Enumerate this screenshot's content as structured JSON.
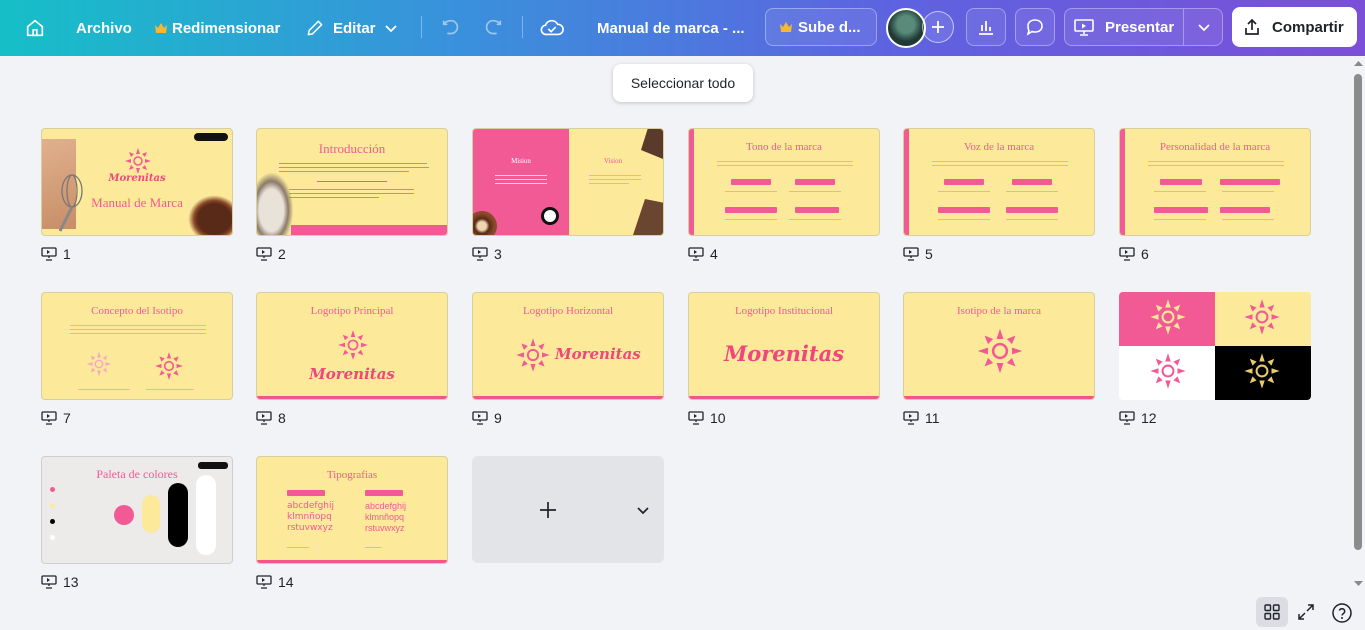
{
  "topbar": {
    "file_label": "Archivo",
    "resize_label": "Redimensionar",
    "edit_label": "Editar",
    "doc_title": "Manual de marca - ...",
    "upgrade_label": "Sube d...",
    "present_label": "Presentar",
    "share_label": "Compartir"
  },
  "tooltip": "Seleccionar todo",
  "slides": [
    {
      "num": "1",
      "title": "Manual de Marca",
      "brand": "Morenitas"
    },
    {
      "num": "2",
      "title": "Introducción"
    },
    {
      "num": "3",
      "left": "Mision",
      "right": "Vision"
    },
    {
      "num": "4",
      "title": "Tono de la marca"
    },
    {
      "num": "5",
      "title": "Voz de la marca"
    },
    {
      "num": "6",
      "title": "Personalidad de la marca"
    },
    {
      "num": "7",
      "title": "Concepto del Isotipo"
    },
    {
      "num": "8",
      "title": "Logotipo Principal",
      "brand": "Morenitas"
    },
    {
      "num": "9",
      "title": "Logotipo Horizontal",
      "brand": "Morenitas"
    },
    {
      "num": "10",
      "title": "Logotipo Institucional",
      "brand": "Morenitas"
    },
    {
      "num": "11",
      "title": "Isotipo de la marca"
    },
    {
      "num": "12"
    },
    {
      "num": "13",
      "title": "Paleta de colores"
    },
    {
      "num": "14",
      "title": "Tipografias",
      "sample1": "abcdefghij",
      "sample2": "klmnñopq",
      "sample3": "rstuvwxyz"
    }
  ],
  "colors": {
    "pink": "#f25a95",
    "cream": "#fde99a",
    "black": "#000000",
    "white": "#ffffff"
  }
}
